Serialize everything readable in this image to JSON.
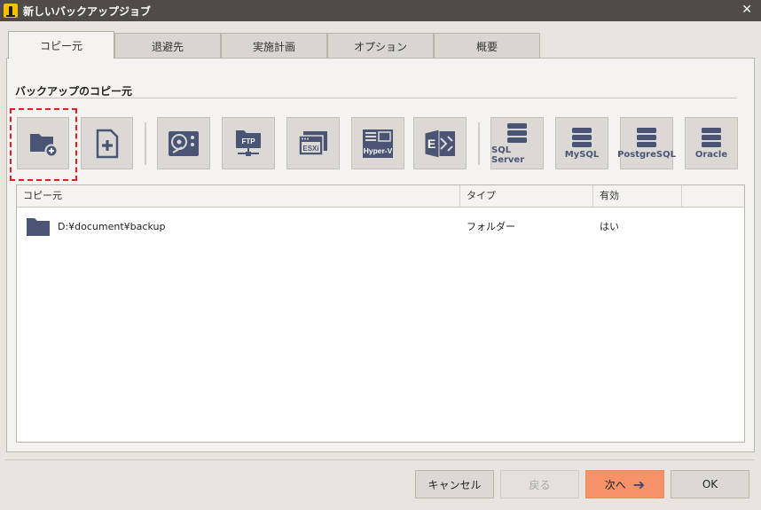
{
  "window": {
    "title": "新しいバックアップジョブ",
    "close": "✕"
  },
  "tabs": [
    {
      "label": "コピー元",
      "active": true
    },
    {
      "label": "退避先"
    },
    {
      "label": "実施計画"
    },
    {
      "label": "オプション"
    },
    {
      "label": "概要"
    }
  ],
  "section": {
    "title": "バックアップのコピー元"
  },
  "source_buttons": [
    {
      "icon": "folder-add-icon",
      "label": ""
    },
    {
      "icon": "file-add-icon",
      "label": ""
    },
    {
      "icon": "disk-icon",
      "label": ""
    },
    {
      "icon": "ftp-icon",
      "label": "FTP"
    },
    {
      "icon": "esxi-icon",
      "label": "ESXi"
    },
    {
      "icon": "hyperv-icon",
      "label": "Hyper-V"
    },
    {
      "icon": "exchange-icon",
      "label": "E"
    },
    {
      "icon": "database-icon",
      "label": "SQL Server"
    },
    {
      "icon": "database-icon",
      "label": "MySQL"
    },
    {
      "icon": "database-icon",
      "label": "PostgreSQL"
    },
    {
      "icon": "database-icon",
      "label": "Oracle"
    }
  ],
  "table": {
    "columns": [
      "コピー元",
      "タイプ",
      "有効"
    ],
    "rows": [
      {
        "source": "D:¥document¥backup",
        "type": "フォルダー",
        "enabled": "はい"
      }
    ]
  },
  "footer": {
    "cancel": "キャンセル",
    "back": "戻る",
    "next": "次へ",
    "next_arrow": "➔",
    "ok": "OK"
  },
  "colors": {
    "icon": "#4a5576",
    "highlight": "#e41e1e",
    "primary": "#f79168",
    "titlebar": "#4f4b47"
  }
}
